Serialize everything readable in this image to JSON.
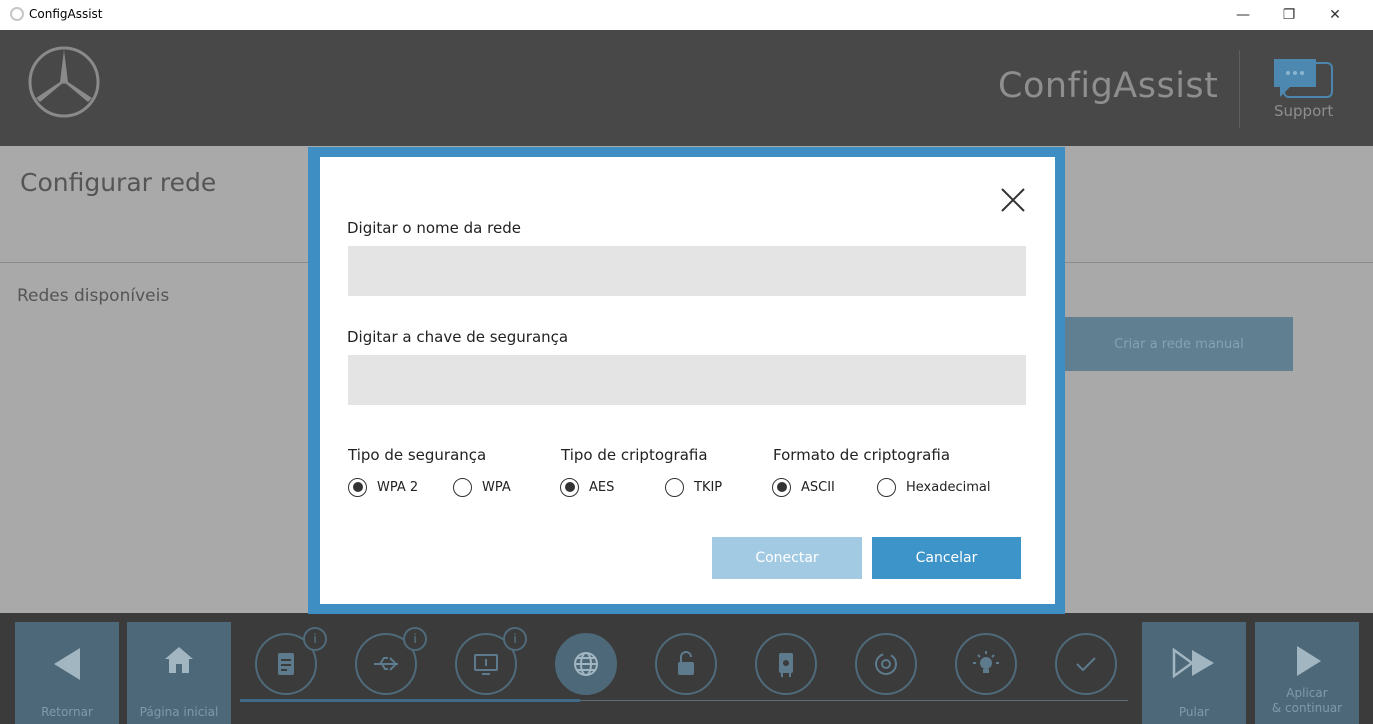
{
  "window": {
    "title": "ConfigAssist",
    "minimize_glyph": "—",
    "maximize_glyph": "❐",
    "close_glyph": "✕"
  },
  "header": {
    "brand": "ConfigAssist",
    "support_label": "Support",
    "logo_icon": "mercedes-star-icon",
    "support_icon": "chat-bubble-icon"
  },
  "page": {
    "title": "Configurar rede",
    "networks_label": "Redes disponíveis",
    "manual_network_button": "Criar a rede manual"
  },
  "dialog": {
    "network_name_label": "Digitar o nome da rede",
    "network_name_value": "",
    "security_key_label": "Digitar a chave de segurança",
    "security_key_value": "",
    "security_type": {
      "label": "Tipo de segurança",
      "options": [
        "WPA 2",
        "WPA"
      ],
      "selected": "WPA 2"
    },
    "encryption_type": {
      "label": "Tipo de criptografia",
      "options": [
        "AES",
        "TKIP"
      ],
      "selected": "AES"
    },
    "encryption_format": {
      "label": "Formato de criptografia",
      "options": [
        "ASCII",
        "Hexadecimal"
      ],
      "selected": "ASCII"
    },
    "connect_button": "Conectar",
    "cancel_button": "Cancelar"
  },
  "bottom_nav": {
    "back": "Retornar",
    "home": "Página inicial",
    "skip": "Pular",
    "apply_line1": "Aplicar",
    "apply_line2": "& continuar",
    "info_glyph": "i",
    "steps": [
      "checklist-icon",
      "usb-icon",
      "monitor-icon",
      "globe-icon",
      "unlock-icon",
      "certificate-icon",
      "sync-icon",
      "lightbulb-icon",
      "checkmark-icon"
    ],
    "active_step": "globe-icon"
  },
  "colors": {
    "header_bg": "#484848",
    "page_bg": "#a9a9a9",
    "modal_frame": "#3e8ec3",
    "primary_button": "#3d94c8",
    "disabled_button": "#a3cae3",
    "nav_bg": "#3b3b3b",
    "nav_button": "#4d6878"
  }
}
